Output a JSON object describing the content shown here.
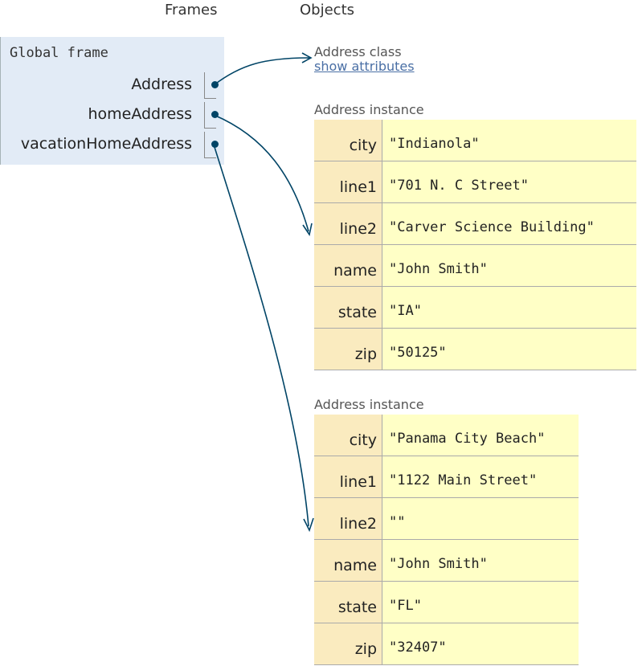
{
  "headers": {
    "frames": "Frames",
    "objects": "Objects"
  },
  "global_frame": {
    "title": "Global frame",
    "variables": [
      {
        "name": "Address"
      },
      {
        "name": "homeAddress"
      },
      {
        "name": "vacationHomeAddress"
      }
    ]
  },
  "address_class": {
    "caption": "Address class",
    "link": "show attributes"
  },
  "instances": [
    {
      "caption": "Address instance",
      "fields": [
        {
          "key": "city",
          "value": "\"Indianola\""
        },
        {
          "key": "line1",
          "value": "\"701 N. C Street\""
        },
        {
          "key": "line2",
          "value": "\"Carver Science Building\""
        },
        {
          "key": "name",
          "value": "\"John Smith\""
        },
        {
          "key": "state",
          "value": "\"IA\""
        },
        {
          "key": "zip",
          "value": "\"50125\""
        }
      ]
    },
    {
      "caption": "Address instance",
      "fields": [
        {
          "key": "city",
          "value": "\"Panama City Beach\""
        },
        {
          "key": "line1",
          "value": "\"1122 Main Street\""
        },
        {
          "key": "line2",
          "value": "\"\""
        },
        {
          "key": "name",
          "value": "\"John Smith\""
        },
        {
          "key": "state",
          "value": "\"FL\""
        },
        {
          "key": "zip",
          "value": "\"32407\""
        }
      ]
    }
  ],
  "colors": {
    "frame_bg": "#e2ebf6",
    "key_bg": "#faebbf",
    "value_bg": "#ffffc6",
    "arrow": "#004466",
    "link": "#4a6fa5"
  }
}
